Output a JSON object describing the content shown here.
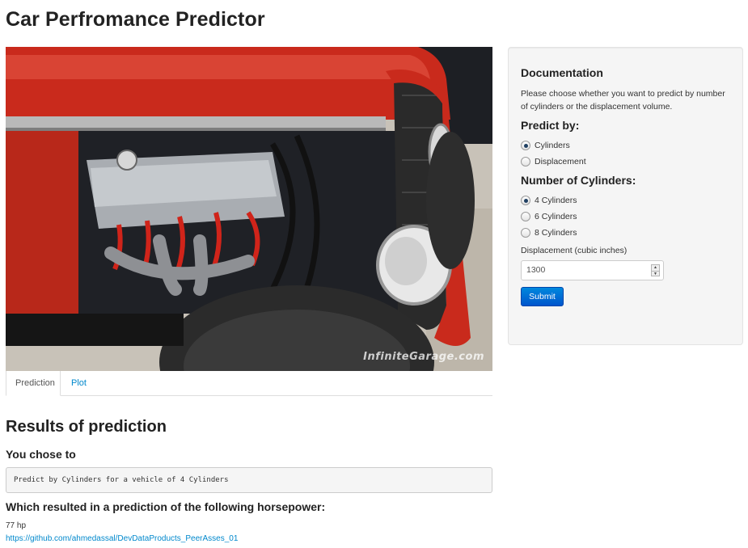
{
  "app": {
    "title": "Car Perfromance Predictor"
  },
  "hero": {
    "watermark": "InfiniteGarage.com"
  },
  "tabs": [
    {
      "label": "Prediction",
      "active": true
    },
    {
      "label": "Plot",
      "active": false
    }
  ],
  "results": {
    "title": "Results of prediction",
    "chose_title": "You chose to",
    "choice_text": "Predict by Cylinders for a vehicle of 4 Cylinders",
    "hp_title": "Which resulted in a prediction of the following horsepower:",
    "hp_value": "77 hp",
    "link": "https://github.com/ahmedassal/DevDataProducts_PeerAsses_01"
  },
  "sidebar": {
    "doc_title": "Documentation",
    "doc_text": "Please choose whether you want to predict by number of cylinders or the displacement volume.",
    "predict_by_label": "Predict by:",
    "predict_by_options": [
      {
        "label": "Cylinders",
        "checked": true
      },
      {
        "label": "Displacement",
        "checked": false
      }
    ],
    "cylinders_label": "Number of Cylinders:",
    "cylinder_options": [
      {
        "label": "4 Cylinders",
        "checked": true
      },
      {
        "label": "6 Cylinders",
        "checked": false
      },
      {
        "label": "8 Cylinders",
        "checked": false
      }
    ],
    "displacement_label": "Displacement (cubic inches)",
    "displacement_value": "1300",
    "submit_label": "Submit"
  },
  "colors": {
    "accent": "#0088cc",
    "button": "#006dcc",
    "car_red": "#c92a1c"
  }
}
